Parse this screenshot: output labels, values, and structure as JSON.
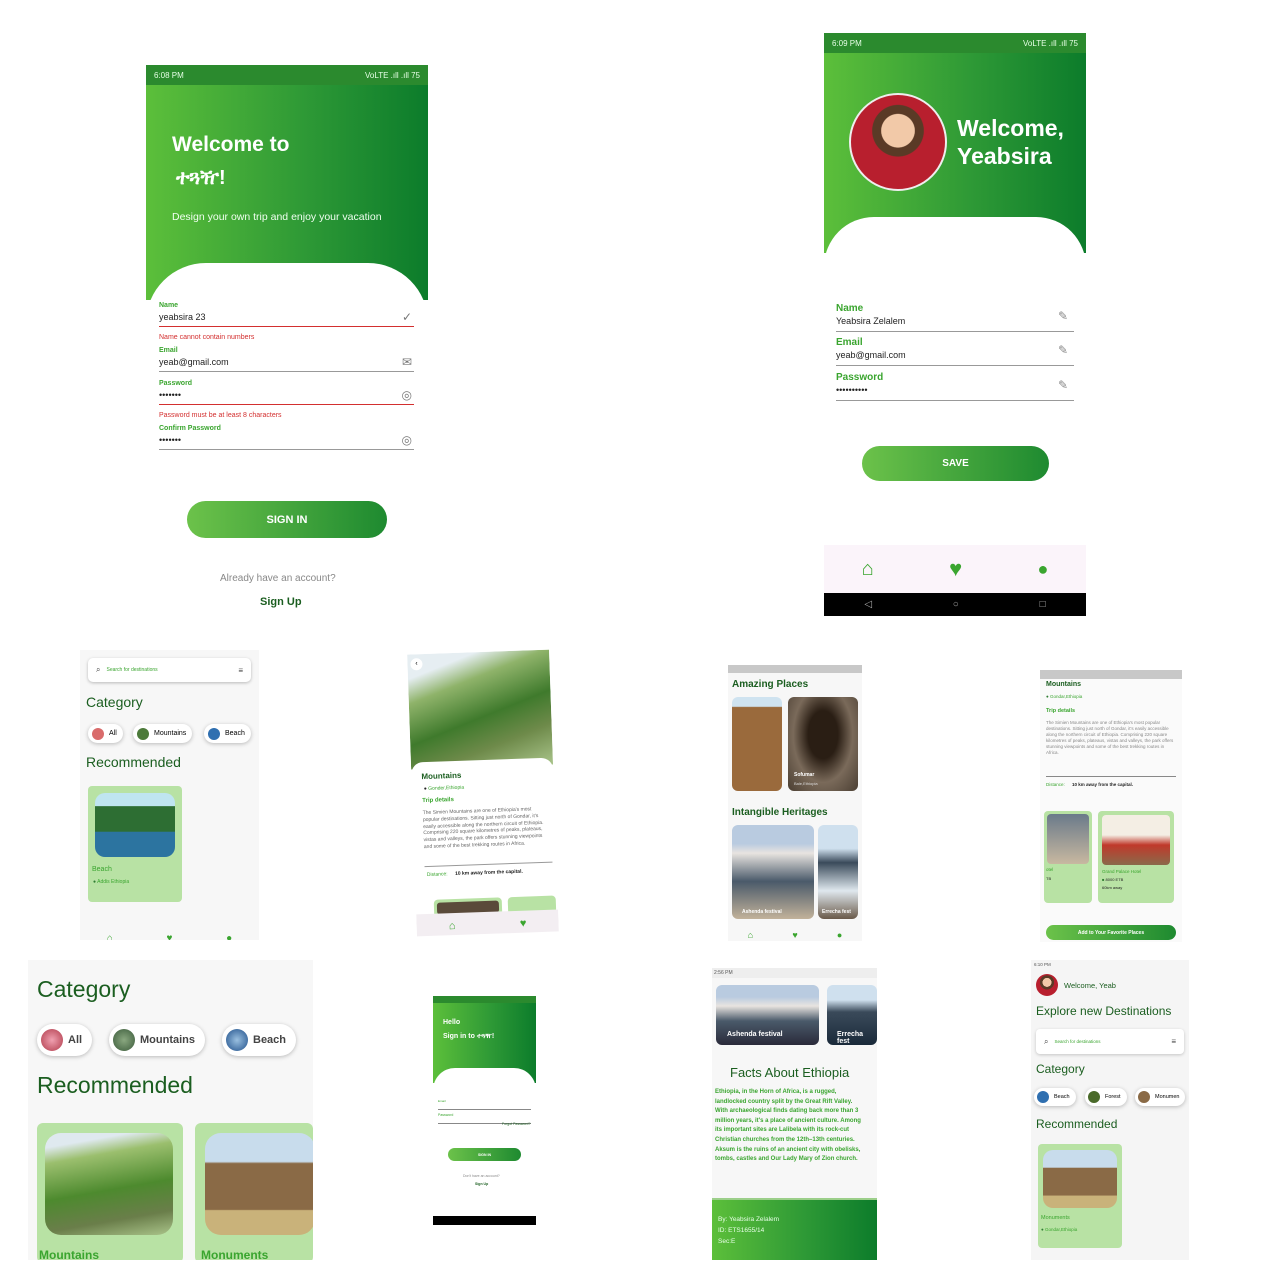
{
  "signup": {
    "status_time": "6:08 PM",
    "status_right": "VoLTE .ıll .ıll 75",
    "welcome_line1": "Welcome to",
    "welcome_line2": "ተጓዥ!",
    "tagline": "Design your own trip and enjoy your vacation",
    "fields": [
      {
        "label": "Name",
        "value": "yeabsira 23"
      },
      {
        "label": "Email",
        "value": "yeab@gmail.com"
      },
      {
        "label": "Password",
        "value": "•••••••"
      },
      {
        "label": "Confirm Password",
        "value": "•••••••"
      }
    ],
    "name_error": "Name cannot contain numbers",
    "password_error": "Password must be at least 8 characters",
    "sign_in_label": "SIGN IN",
    "already_text": "Already have an account?",
    "sign_up_label": "Sign Up"
  },
  "profile": {
    "status_time": "6:09 PM",
    "status_right": "VoLTE .ıll .ıll 75",
    "welcome_line1": "Welcome,",
    "welcome_line2": "Yeabsira",
    "fields": [
      {
        "label": "Name",
        "value": "Yeabsira Zelalem"
      },
      {
        "label": "Email",
        "value": "yeab@gmail.com"
      },
      {
        "label": "Password",
        "value": "••••••••••"
      }
    ],
    "save_label": "SAVE",
    "nav": [
      "home-icon",
      "heart-icon",
      "person-icon"
    ]
  },
  "home_small": {
    "search_placeholder": "Search for destinations",
    "category_title": "Category",
    "chips": [
      "All",
      "Mountains",
      "Beach"
    ],
    "recommended_title": "Recommended",
    "card_title": "Beach",
    "card_location": "Addis Ethiopia"
  },
  "detail1": {
    "title": "Mountains",
    "location": "Gonder,Ethiopia",
    "trip_details": "Trip details",
    "description": "The Simien Mountains are one of Ethiopia's most popular destinations. Sitting just north of Gondar, it's easily accessible along the northern circuit of Ethiopia. Comprising 220 square kilometres of peaks, plateaus, vistas and valleys, the park offers stunning viewpoints and some of the best trekking routes in Africa.",
    "distance_label": "Distance:",
    "distance_value": "10 km away from the capital."
  },
  "amazing": {
    "title1": "Amazing Places",
    "place2_name": "Sofumar",
    "place2_loc": "Bale,Ethiopia",
    "title2": "Intangible Heritages",
    "heritage1": "Ashenda festival",
    "heritage2": "Errecha fest"
  },
  "detail2": {
    "title": "Mountains",
    "location": "Gondar,Ethiopia",
    "trip_details": "Trip details",
    "description": "The Simien Mountains are one of Ethiopia's most popular destinations. Sitting just north of Gondar, it's easily accessible along the northern circuit of Ethiopia. Comprising 220 square kilometres of peaks, plateaus, vistas and valleys, the park offers stunning viewpoints and some of the best trekking routes in Africa.",
    "distance_label": "Distance:",
    "distance_value": "10 km away from the capital.",
    "hotel1": "otel",
    "hotel1_price": "TB",
    "hotel2": "Grand Palace Hotel",
    "hotel2_price": "8000 ETB",
    "hotel2_dist": "60km away",
    "fav_button": "Add to Your Favorite Places"
  },
  "category_large": {
    "category_title": "Category",
    "chips": [
      "All",
      "Mountains",
      "Beach"
    ],
    "recommended_title": "Recommended",
    "card1": "Mountains",
    "card2": "Monuments"
  },
  "login_small": {
    "hello": "Hello",
    "sign_in_to": "Sign in to ተጓዥ!",
    "email_label": "Email",
    "password_label": "Password",
    "forgot": "Forgot Password?",
    "sign_in": "SIGN IN",
    "no_account": "Don't have an account?",
    "sign_up": "Sign Up"
  },
  "facts": {
    "status_time": "2:56 PM",
    "festival1": "Ashenda festival",
    "festival2": "Errecha fest",
    "title": "Facts About Ethiopia",
    "body": "Ethiopia, in the Horn of Africa, is a rugged, landlocked country split by the Great Rift Valley. With archaeological finds dating back more than 3 million years, it's a place of ancient culture. Among its important sites are Lalibela with its rock-cut Christian churches from the 12th–13th centuries. Aksum is the ruins of an ancient city with obelisks, tombs, castles and Our Lady Mary of Zion church.",
    "by": "By: Yeabsira Zelalem",
    "id": "ID: ETS1655/14",
    "sec": "Sec:E"
  },
  "explore": {
    "status_time": "6:10 PM",
    "welcome": "Welcome, Yeab",
    "title": "Explore new Destinations",
    "search_placeholder": "Search for destinations",
    "category_title": "Category",
    "chips": [
      "Beach",
      "Forest",
      "Monumen"
    ],
    "recommended_title": "Recommended",
    "card_title": "Monuments",
    "card_location": "Gondar,Ethiopia"
  }
}
